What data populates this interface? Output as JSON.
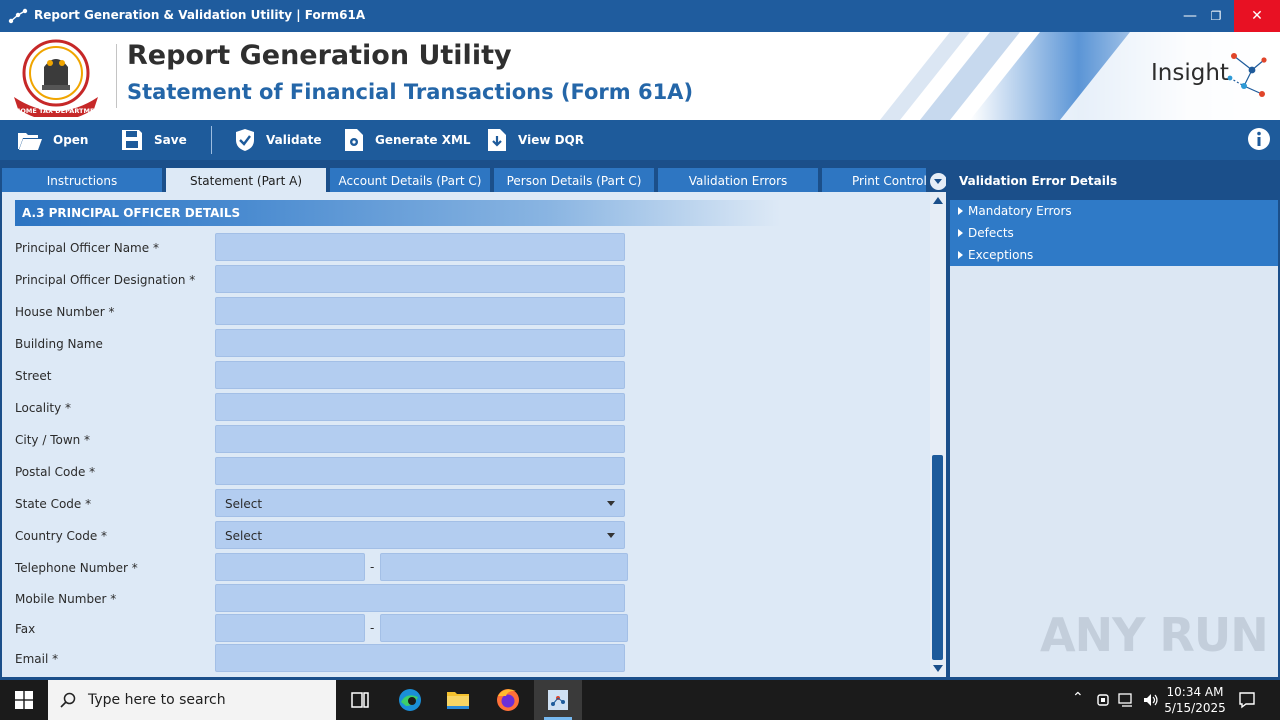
{
  "window": {
    "title": "Report Generation & Validation Utility | Form61A"
  },
  "header": {
    "title": "Report Generation Utility",
    "subtitle": "Statement of Financial Transactions (Form 61A)",
    "logo_text": "INCOME TAX DEPARTMENT",
    "brand": "Insight"
  },
  "toolbar": {
    "open": "Open",
    "save": "Save",
    "validate": "Validate",
    "generate_xml": "Generate XML",
    "view_dqr": "View DQR"
  },
  "tabs": [
    {
      "label": "Instructions",
      "active": false
    },
    {
      "label": "Statement (Part A)",
      "active": true
    },
    {
      "label": "Account Details (Part C)",
      "active": false
    },
    {
      "label": "Person Details (Part C)",
      "active": false
    },
    {
      "label": "Validation Errors",
      "active": false
    },
    {
      "label": "Print Control",
      "active": false
    }
  ],
  "section": {
    "title": "A.3 PRINCIPAL OFFICER DETAILS"
  },
  "fields": {
    "principal_officer_name": "Principal Officer Name *",
    "principal_officer_designation": "Principal Officer Designation *",
    "house_number": "House Number *",
    "building_name": "Building Name",
    "street": "Street",
    "locality": "Locality *",
    "city_town": "City / Town *",
    "postal_code": "Postal Code *",
    "state_code": "State Code *",
    "country_code": "Country Code *",
    "telephone_number": "Telephone Number *",
    "mobile_number": "Mobile Number *",
    "fax": "Fax",
    "email": "Email *"
  },
  "selects": {
    "state_code_value": "Select",
    "country_code_value": "Select"
  },
  "separator": "-",
  "right_panel": {
    "title": "Validation Error Details",
    "items": [
      "Mandatory Errors",
      "Defects",
      "Exceptions"
    ]
  },
  "watermark": "ANY RUN",
  "taskbar": {
    "search_placeholder": "Type here to search",
    "time": "10:34 AM",
    "date": "5/15/2025"
  },
  "colors": {
    "primary": "#1e5b9b",
    "tab_inactive": "#2e76c2",
    "field_bg": "#b3cdf0",
    "panel_bg": "#dde9f6",
    "close_red": "#e81123"
  }
}
